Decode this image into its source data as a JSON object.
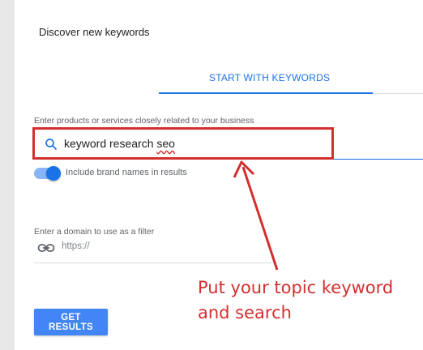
{
  "panel": {
    "title": "Discover new keywords",
    "tab_label": "START WITH KEYWORDS"
  },
  "search": {
    "label": "Enter products or services closely related to your business",
    "value_main": "keyword research ",
    "value_misspelled": "seo",
    "icon": "search-icon"
  },
  "brand_toggle": {
    "label": "Include brand names in results",
    "enabled": true
  },
  "domain_filter": {
    "label": "Enter a domain to use as a filter",
    "placeholder": "https://",
    "icon": "link-icon"
  },
  "actions": {
    "get_results_label": "GET RESULTS"
  },
  "annotation": {
    "line1": "Put your topic keyword",
    "line2": "and search",
    "color": "#d32f2f"
  },
  "colors": {
    "accent": "#1a73e8",
    "button": "#4285f4"
  }
}
